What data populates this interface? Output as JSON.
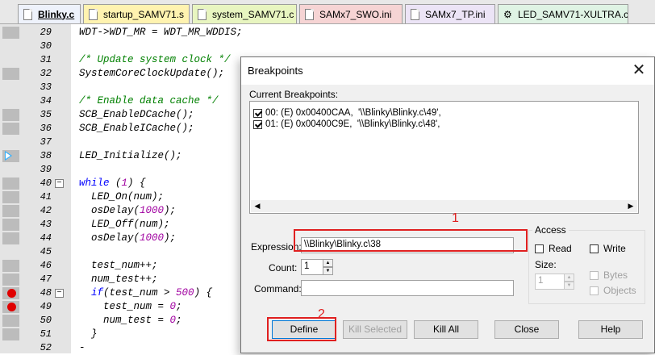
{
  "tabs": [
    {
      "label": "Blinky.c",
      "active": true,
      "color": "#eef2fb"
    },
    {
      "label": "startup_SAMV71.s",
      "active": false,
      "color": "#fff3b0"
    },
    {
      "label": "system_SAMV71.c",
      "active": false,
      "color": "#e8f5c0"
    },
    {
      "label": "SAMx7_SWO.ini",
      "active": false,
      "color": "#f6d4d4"
    },
    {
      "label": "SAMx7_TP.ini",
      "active": false,
      "color": "#ece4f6"
    },
    {
      "label": "LED_SAMV71-XULTRA.c",
      "active": false,
      "color": "#dff3e4"
    }
  ],
  "code_lines": [
    {
      "num": "29",
      "text": "WDT->WDT_MR = WDT_MR_WDDIS;"
    },
    {
      "num": "30",
      "text": ""
    },
    {
      "num": "31",
      "text": "/* Update system clock */"
    },
    {
      "num": "32",
      "text": "SystemCoreClockUpdate();"
    },
    {
      "num": "33",
      "text": ""
    },
    {
      "num": "34",
      "text": "/* Enable data cache */"
    },
    {
      "num": "35",
      "text": "SCB_EnableDCache();"
    },
    {
      "num": "36",
      "text": "SCB_EnableICache();"
    },
    {
      "num": "37",
      "text": ""
    },
    {
      "num": "38",
      "text": "LED_Initialize();"
    },
    {
      "num": "39",
      "text": ""
    },
    {
      "num": "40",
      "text": "while (1) {"
    },
    {
      "num": "41",
      "text": "  LED_On(num);"
    },
    {
      "num": "42",
      "text": "  osDelay(1000);"
    },
    {
      "num": "43",
      "text": "  LED_Off(num);"
    },
    {
      "num": "44",
      "text": "  osDelay(1000);"
    },
    {
      "num": "45",
      "text": ""
    },
    {
      "num": "46",
      "text": "  test_num++;"
    },
    {
      "num": "47",
      "text": "  num_test++;"
    },
    {
      "num": "48",
      "text": "  if(test_num > 500) {"
    },
    {
      "num": "49",
      "text": "    test_num = 0;"
    },
    {
      "num": "50",
      "text": "    num_test = 0;"
    },
    {
      "num": "51",
      "text": "  }"
    },
    {
      "num": "52",
      "text": "-"
    }
  ],
  "dialog": {
    "title": "Breakpoints",
    "current_label": "Current Breakpoints:",
    "breakpoints": [
      {
        "text": "00: (E) 0x00400CAA,  '\\\\Blinky\\Blinky.c\\49',",
        "checked": true
      },
      {
        "text": "01: (E) 0x00400C9E,  '\\\\Blinky\\Blinky.c\\48',",
        "checked": true
      }
    ],
    "expression_label": "Expression:",
    "expression_value": "\\\\Blinky\\Blinky.c\\38",
    "count_label": "Count:",
    "count_value": "1",
    "command_label": "Command:",
    "command_value": "",
    "access": {
      "title": "Access",
      "read_label": "Read",
      "write_label": "Write",
      "size_label": "Size:",
      "size_value": "1",
      "bytes_label": "Bytes",
      "objects_label": "Objects"
    },
    "buttons": {
      "define": "Define",
      "kill_selected": "Kill Selected",
      "kill_all": "Kill All",
      "close": "Close",
      "help": "Help"
    }
  },
  "annotations": {
    "one": "1",
    "two": "2",
    "color": "#e02020"
  }
}
